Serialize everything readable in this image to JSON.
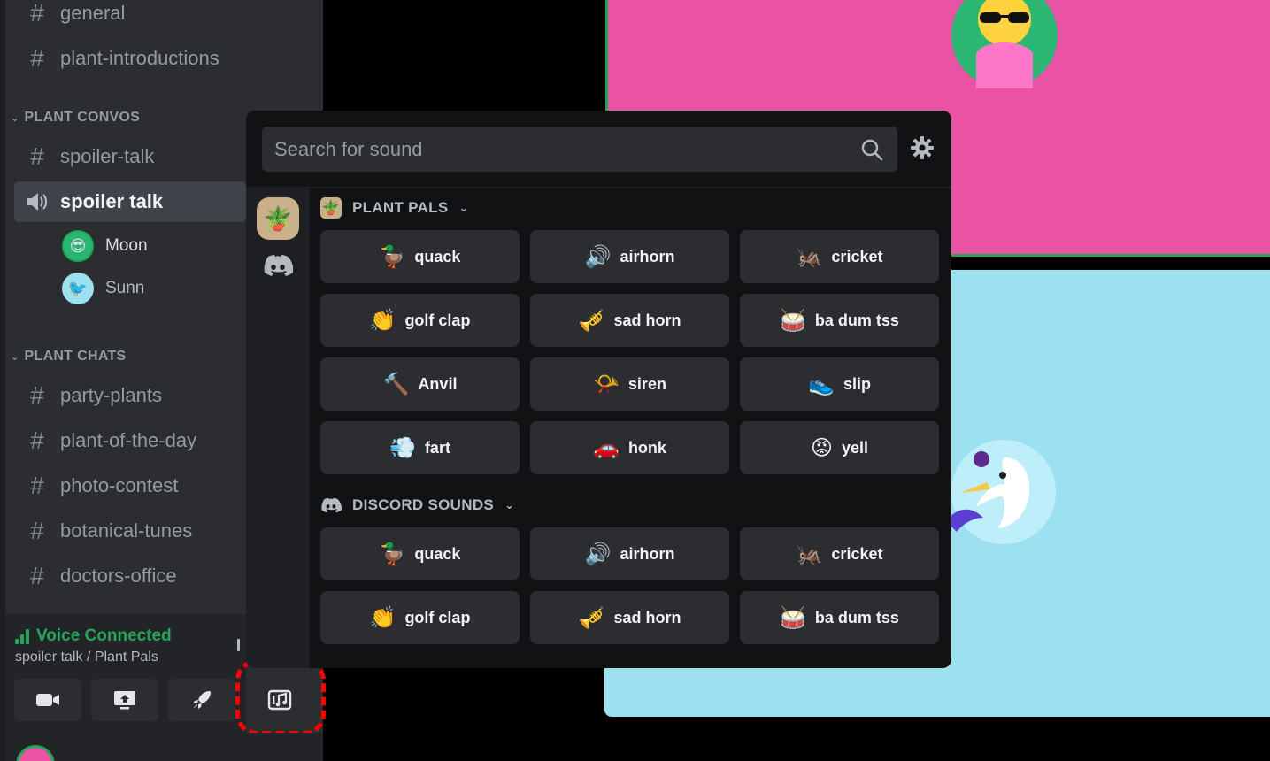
{
  "sidebar": {
    "channels_top": [
      {
        "label": "general"
      },
      {
        "label": "plant-introductions"
      }
    ],
    "category_1": "PLANT CONVOS",
    "convos": [
      {
        "label": "spoiler-talk",
        "kind": "text"
      },
      {
        "label": "spoiler talk",
        "kind": "voice",
        "active": true
      }
    ],
    "members": [
      {
        "name": "Moon",
        "avatar": "sunglasses-avatar"
      },
      {
        "name": "Sunn",
        "avatar": "bird-avatar"
      }
    ],
    "category_2": "PLANT CHATS",
    "chats": [
      {
        "label": "party-plants"
      },
      {
        "label": "plant-of-the-day"
      },
      {
        "label": "photo-contest"
      },
      {
        "label": "botanical-tunes"
      },
      {
        "label": "doctors-office"
      }
    ],
    "voice": {
      "status": "Voice Connected",
      "location": "spoiler talk / Plant Pals"
    }
  },
  "soundboard": {
    "search_placeholder": "Search for sound",
    "sections": [
      {
        "title": "PLANT PALS",
        "icon": "plant-pot-icon",
        "sounds": [
          {
            "emoji": "🦆",
            "label": "quack"
          },
          {
            "emoji": "🔊",
            "label": "airhorn"
          },
          {
            "emoji": "🦗",
            "label": "cricket"
          },
          {
            "emoji": "👏",
            "label": "golf clap"
          },
          {
            "emoji": "🎺",
            "label": "sad horn"
          },
          {
            "emoji": "🥁",
            "label": "ba dum tss"
          },
          {
            "emoji": "🔨",
            "label": "Anvil"
          },
          {
            "emoji": "📯",
            "label": "siren"
          },
          {
            "emoji": "👟",
            "label": "slip"
          },
          {
            "emoji": "💨",
            "label": "fart"
          },
          {
            "emoji": "🚗",
            "label": "honk"
          },
          {
            "emoji": "😡",
            "label": "yell"
          }
        ]
      },
      {
        "title": "DISCORD SOUNDS",
        "icon": "discord-icon",
        "sounds": [
          {
            "emoji": "🦆",
            "label": "quack"
          },
          {
            "emoji": "🔊",
            "label": "airhorn"
          },
          {
            "emoji": "🦗",
            "label": "cricket"
          },
          {
            "emoji": "👏",
            "label": "golf clap"
          },
          {
            "emoji": "🎺",
            "label": "sad horn"
          },
          {
            "emoji": "🥁",
            "label": "ba dum tss"
          }
        ]
      }
    ]
  },
  "colors": {
    "accent_green": "#23a55a",
    "tile_pink": "#ea53a4",
    "tile_blue": "#9de1f1",
    "highlight_red": "#ff0000"
  }
}
